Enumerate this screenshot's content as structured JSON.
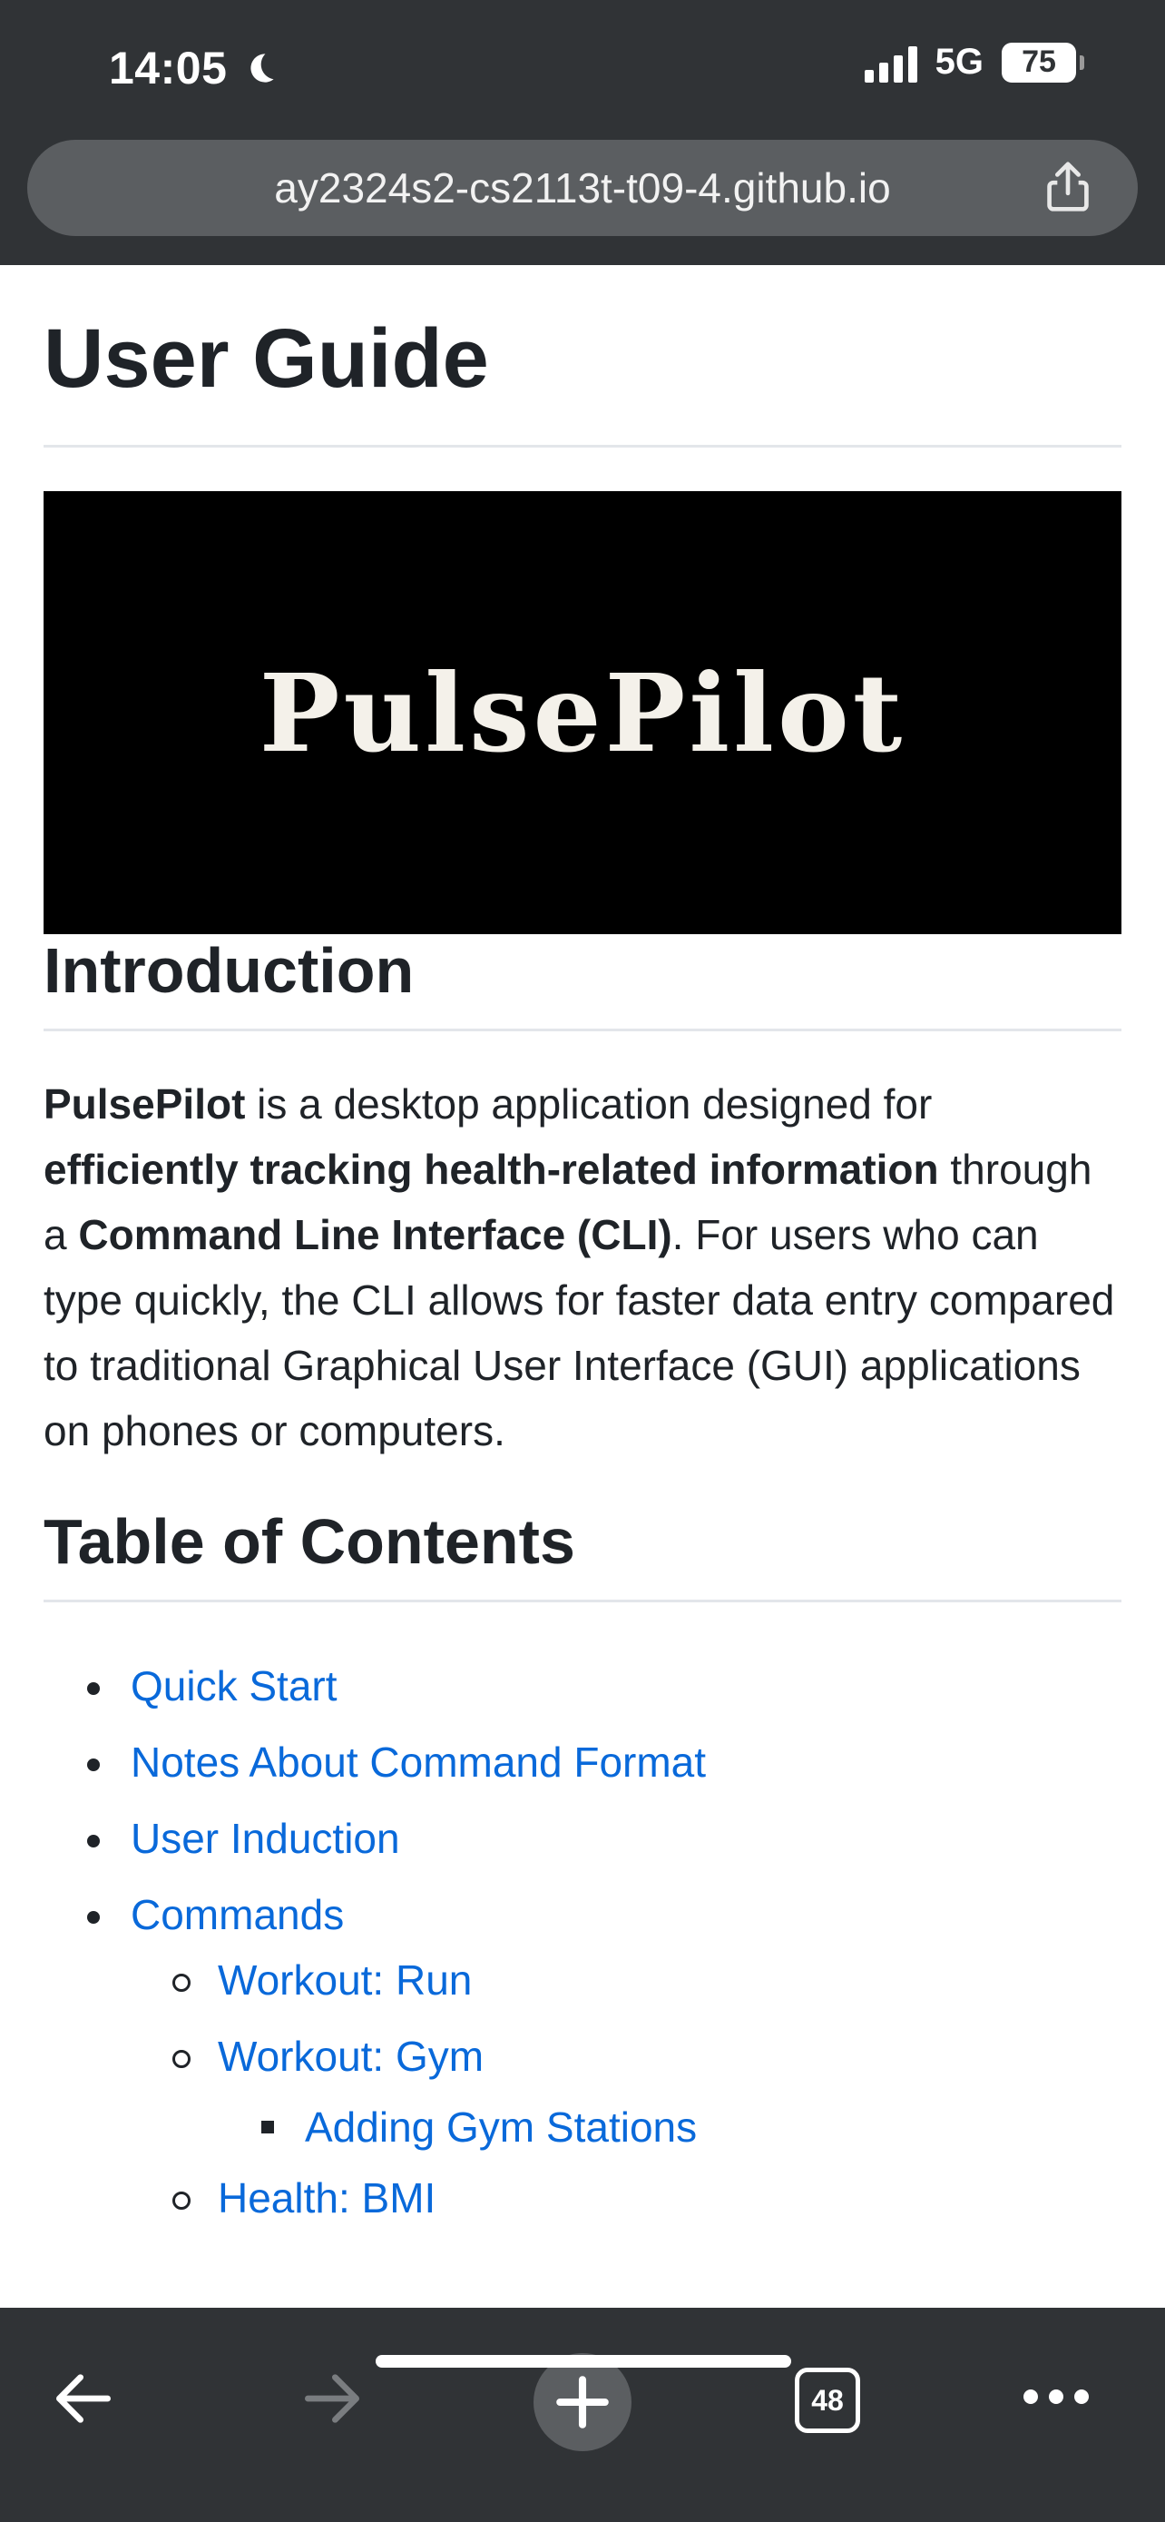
{
  "status_bar": {
    "time": "14:05",
    "network": "5G",
    "battery": "75"
  },
  "browser": {
    "url": "ay2324s2-cs2113t-t09-4.github.io",
    "tab_count": "48"
  },
  "page": {
    "title": "User Guide",
    "banner_text": "PulsePilot",
    "introduction": {
      "heading": "Introduction",
      "segments": [
        {
          "text": "PulsePilot",
          "bold": true
        },
        {
          "text": " is a desktop application designed for ",
          "bold": false
        },
        {
          "text": "efficiently tracking health-related information",
          "bold": true
        },
        {
          "text": " through a ",
          "bold": false
        },
        {
          "text": "Command Line Interface (CLI)",
          "bold": true
        },
        {
          "text": ". For users who can type quickly, the CLI allows for faster data entry compared to traditional Graphical User Interface (GUI) applications on phones or computers.",
          "bold": false
        }
      ]
    },
    "toc": {
      "heading": "Table of Contents",
      "items": [
        {
          "label": "Quick Start",
          "level": 1
        },
        {
          "label": "Notes About Command Format",
          "level": 1
        },
        {
          "label": "User Induction",
          "level": 1
        },
        {
          "label": "Commands",
          "level": 1
        },
        {
          "label": "Workout: Run",
          "level": 2
        },
        {
          "label": "Workout: Gym",
          "level": 2
        },
        {
          "label": "Adding Gym Stations",
          "level": 3
        },
        {
          "label": "Health: BMI",
          "level": 2
        }
      ]
    }
  },
  "toolbar": {
    "icons": [
      "back-arrow-icon",
      "forward-arrow-icon",
      "plus-icon",
      "tabs-icon",
      "more-icon"
    ]
  }
}
